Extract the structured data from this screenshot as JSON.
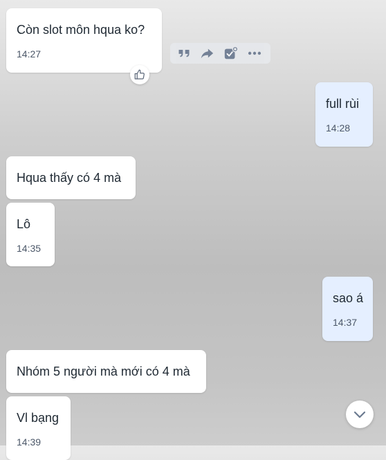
{
  "messages": [
    {
      "text": "Còn slot môn hqua ko?",
      "time": "14:27",
      "direction": "incoming"
    },
    {
      "text": "full rùi",
      "time": "14:28",
      "direction": "outgoing"
    },
    {
      "text": "Hqua thấy có 4 mà",
      "time": "",
      "direction": "incoming"
    },
    {
      "text": "Lô",
      "time": "14:35",
      "direction": "incoming"
    },
    {
      "text": "sao á",
      "time": "14:37",
      "direction": "outgoing"
    },
    {
      "text": "Nhóm 5 người mà mới có 4 mà",
      "time": "",
      "direction": "incoming"
    },
    {
      "text": "Vl bạng",
      "time": "14:39",
      "direction": "incoming"
    }
  ],
  "toolbar": {
    "icons": [
      "quote-icon",
      "forward-icon",
      "add-task-icon",
      "more-icon"
    ]
  },
  "reaction_icon": "thumbs-up-icon",
  "scroll_button_icon": "chevron-down-icon",
  "colors": {
    "incoming_bubble": "#ffffff",
    "outgoing_bubble": "#e5efff",
    "icon": "#6b7a90",
    "text": "#1f2933",
    "time": "#4b5768"
  }
}
